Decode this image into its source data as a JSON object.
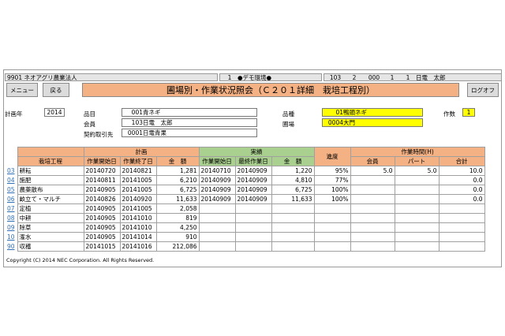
{
  "info_bar": {
    "company_code": "9901",
    "company_name": "ネオアグリ農業法人",
    "env_no": "1",
    "env_name": "●デモ環境●",
    "code1": "103",
    "code2": "2",
    "code3": "000",
    "code4": "1",
    "code5": "1",
    "user": "日電　太郎"
  },
  "buttons": {
    "menu": "メニュー",
    "back": "戻る",
    "logoff": "ログオフ"
  },
  "title": "圃場別・作業状況照会（Ｃ２０１詳細　栽培工程別）",
  "form": {
    "plan_year_label": "計画年",
    "plan_year": "2014",
    "item_label": "品目",
    "item_code": "001",
    "item_name": "青ネギ",
    "member_label": "会員",
    "member_code": "103",
    "member_name": "日電　太郎",
    "contract_label": "契約取引先",
    "contract_code": "0001",
    "contract_name": "日電青果",
    "variety_label": "品種",
    "variety_code": "01",
    "variety_name": "鴨頭ネギ",
    "field_label": "圃場",
    "field_code": "0004",
    "field_name": "大門",
    "crop_count_label": "作数",
    "crop_count": "1"
  },
  "table": {
    "group_headers": {
      "plan": "計画",
      "actual": "実績",
      "progress": "進度",
      "work_hours": "作業時間(H)"
    },
    "col_headers": {
      "process": "栽培工程",
      "plan_start": "作業開始日",
      "plan_end": "作業終了日",
      "plan_amount": "金　額",
      "act_start": "作業開始日",
      "act_last": "最終作業日",
      "act_amount": "金　額",
      "hours_member": "会員",
      "hours_part": "パート",
      "hours_total": "合計"
    },
    "rows": [
      {
        "no": "03",
        "process": "耕耘",
        "plan_start": "20140720",
        "plan_end": "20140821",
        "plan_amount": "1,281",
        "act_start": "20140710",
        "act_last": "20140909",
        "act_amount": "1,220",
        "progress": "95%",
        "member": "5.0",
        "part": "5.0",
        "total": "10.0"
      },
      {
        "no": "04",
        "process": "施肥",
        "plan_start": "20140811",
        "plan_end": "20141005",
        "plan_amount": "6,210",
        "act_start": "20140909",
        "act_last": "20140909",
        "act_amount": "4,810",
        "progress": "77%",
        "member": "",
        "part": "",
        "total": "0.0"
      },
      {
        "no": "05",
        "process": "農薬散布",
        "plan_start": "20140905",
        "plan_end": "20141005",
        "plan_amount": "6,725",
        "act_start": "20140909",
        "act_last": "20140909",
        "act_amount": "6,725",
        "progress": "100%",
        "member": "",
        "part": "",
        "total": "0.0"
      },
      {
        "no": "06",
        "process": "畝立て・マルチ",
        "plan_start": "20140826",
        "plan_end": "20140920",
        "plan_amount": "11,633",
        "act_start": "20140909",
        "act_last": "20140909",
        "act_amount": "11,633",
        "progress": "100%",
        "member": "",
        "part": "",
        "total": "0.0"
      },
      {
        "no": "07",
        "process": "定植",
        "plan_start": "20140905",
        "plan_end": "20141005",
        "plan_amount": "2,058",
        "act_start": "",
        "act_last": "",
        "act_amount": "",
        "progress": "",
        "member": "",
        "part": "",
        "total": ""
      },
      {
        "no": "08",
        "process": "中耕",
        "plan_start": "20140905",
        "plan_end": "20141010",
        "plan_amount": "819",
        "act_start": "",
        "act_last": "",
        "act_amount": "",
        "progress": "",
        "member": "",
        "part": "",
        "total": ""
      },
      {
        "no": "09",
        "process": "除草",
        "plan_start": "20140905",
        "plan_end": "20141010",
        "plan_amount": "4,250",
        "act_start": "",
        "act_last": "",
        "act_amount": "",
        "progress": "",
        "member": "",
        "part": "",
        "total": ""
      },
      {
        "no": "10",
        "process": "潅水",
        "plan_start": "20140905",
        "plan_end": "20141014",
        "plan_amount": "910",
        "act_start": "",
        "act_last": "",
        "act_amount": "",
        "progress": "",
        "member": "",
        "part": "",
        "total": ""
      },
      {
        "no": "90",
        "process": "収穫",
        "plan_start": "20141015",
        "plan_end": "20141016",
        "plan_amount": "212,086",
        "act_start": "",
        "act_last": "",
        "act_amount": "",
        "progress": "",
        "member": "",
        "part": "",
        "total": ""
      }
    ]
  },
  "copyright": "Copyright (C) 2014 NEC Corporation. All Rights Reserved."
}
